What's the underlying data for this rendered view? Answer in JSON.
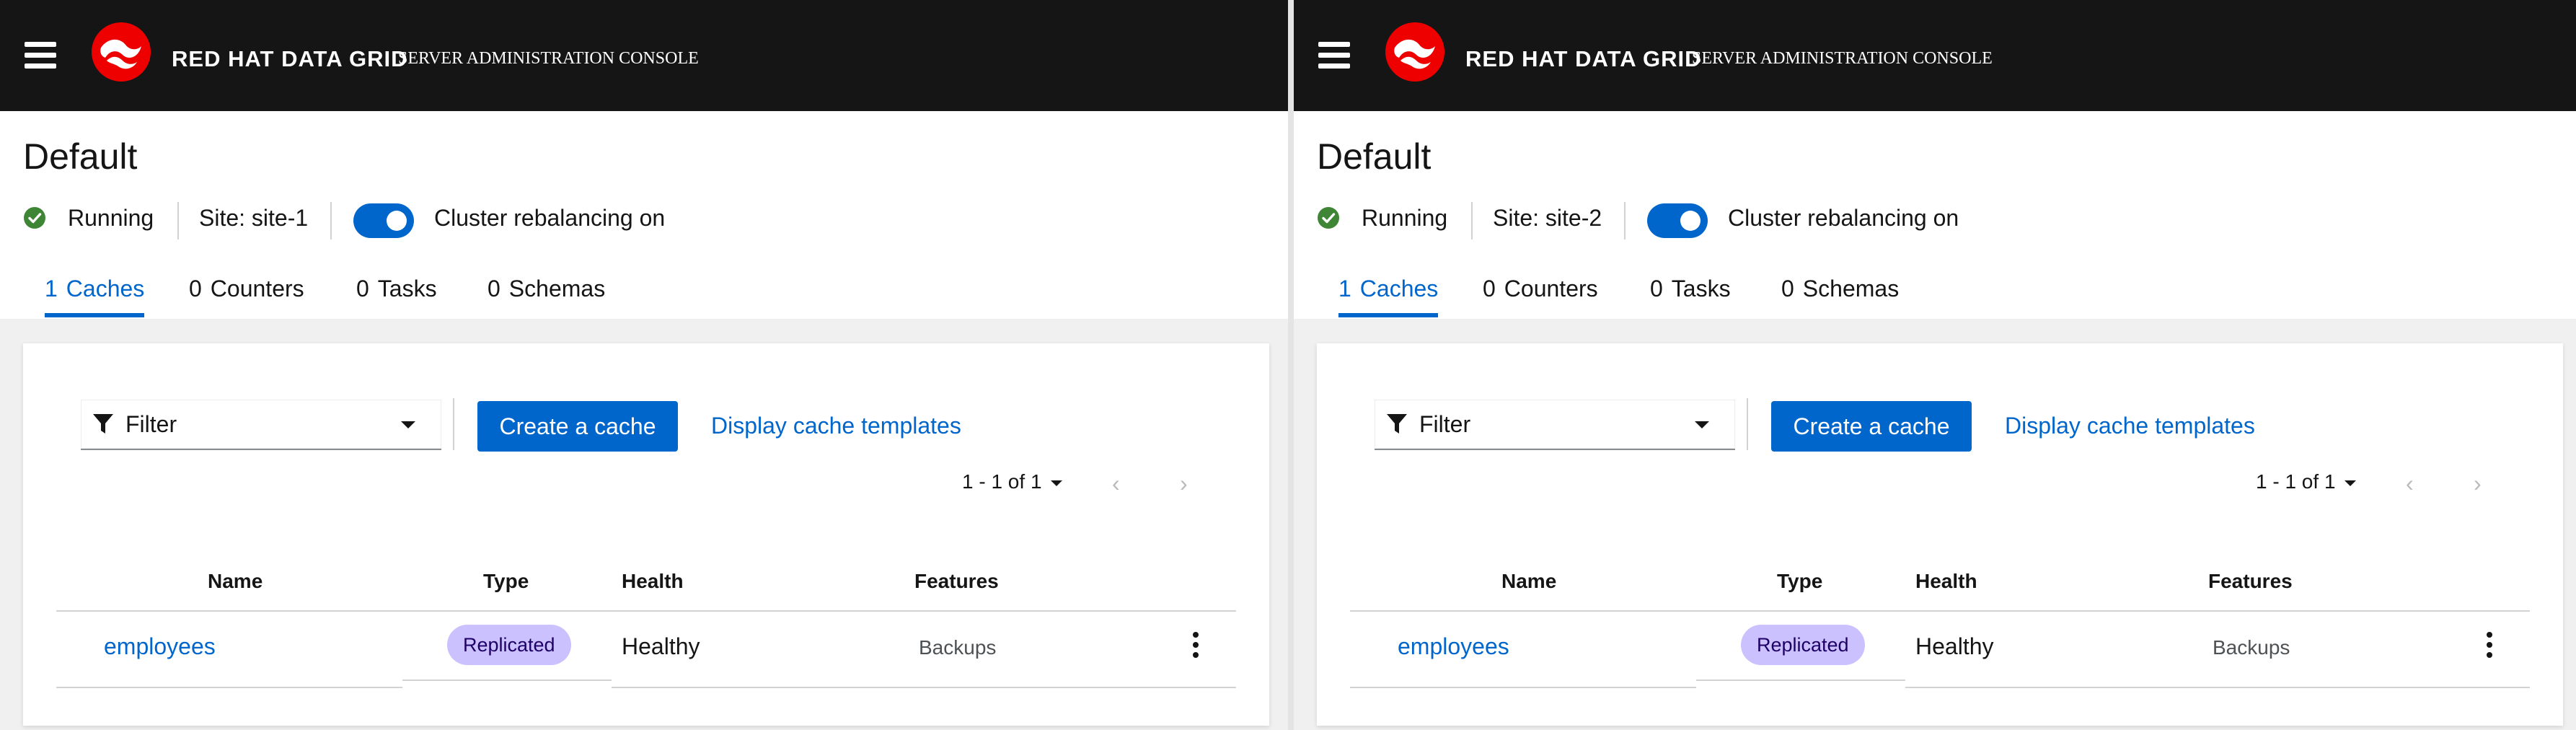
{
  "colors": {
    "masthead": "#151515",
    "accent": "#0066cc",
    "badge_bg": "#cbc1ff",
    "status_ok": "#3e8635"
  },
  "panels": [
    {
      "brand": "RED HAT DATA GRID",
      "brand_sub": "SERVER ADMINISTRATION CONSOLE",
      "title": "Default",
      "status": "Running",
      "site": "Site: site-1",
      "rebalancing_label": "Cluster rebalancing on",
      "rebalancing_on": true,
      "tabs": [
        {
          "count": "1",
          "label": "Caches",
          "active": true
        },
        {
          "count": "0",
          "label": "Counters"
        },
        {
          "count": "0",
          "label": "Tasks"
        },
        {
          "count": "0",
          "label": "Schemas"
        }
      ],
      "filter_label": "Filter",
      "create_button": "Create a cache",
      "templates_link": "Display cache templates",
      "pagination": "1 - 1 of 1",
      "columns": [
        "Name",
        "Type",
        "Health",
        "Features"
      ],
      "rows": [
        {
          "name": "employees",
          "type": "Replicated",
          "health": "Healthy",
          "features": "Backups"
        }
      ]
    },
    {
      "brand": "RED HAT DATA GRID",
      "brand_sub": "SERVER ADMINISTRATION CONSOLE",
      "title": "Default",
      "status": "Running",
      "site": "Site: site-2",
      "rebalancing_label": "Cluster rebalancing on",
      "rebalancing_on": true,
      "tabs": [
        {
          "count": "1",
          "label": "Caches",
          "active": true
        },
        {
          "count": "0",
          "label": "Counters"
        },
        {
          "count": "0",
          "label": "Tasks"
        },
        {
          "count": "0",
          "label": "Schemas"
        }
      ],
      "filter_label": "Filter",
      "create_button": "Create a cache",
      "templates_link": "Display cache templates",
      "pagination": "1 - 1 of 1",
      "columns": [
        "Name",
        "Type",
        "Health",
        "Features"
      ],
      "rows": [
        {
          "name": "employees",
          "type": "Replicated",
          "health": "Healthy",
          "features": "Backups"
        }
      ]
    }
  ]
}
